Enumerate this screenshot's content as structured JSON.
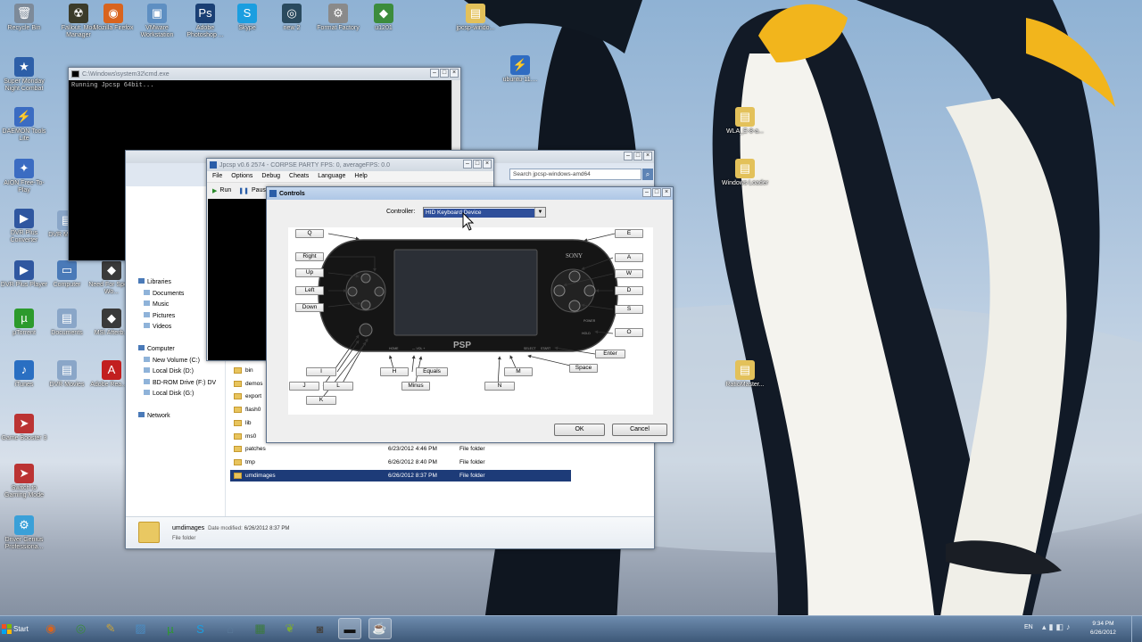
{
  "desktop": {
    "icons": [
      {
        "label": "Recycle Bin",
        "glyph": "🗑",
        "color": "#7d8a99"
      },
      {
        "label": "Fallout: Mod Manager",
        "glyph": "☢",
        "color": "#3b3b2a"
      },
      {
        "label": "Mozilla Firefox",
        "glyph": "◉",
        "color": "#d9641e"
      },
      {
        "label": "VMware Workstation",
        "glyph": "▣",
        "color": "#5e8fc2"
      },
      {
        "label": "Adobe Photoshop ...",
        "glyph": "Ps",
        "color": "#1a3f74"
      },
      {
        "label": "Skype",
        "glyph": "S",
        "color": "#1b9ee0"
      },
      {
        "label": "new 2",
        "glyph": "◎",
        "color": "#2a4a5e"
      },
      {
        "label": "Format Factory",
        "glyph": "⚙",
        "color": "#8a8a8a"
      },
      {
        "label": "u1201",
        "glyph": "◆",
        "color": "#3c8c3c"
      },
      {
        "label": "jpcsp-windo...",
        "glyph": "▤",
        "color": "#e3c15a"
      },
      {
        "label": "Super Monday Night Combat",
        "glyph": "★",
        "color": "#2d5fa8"
      },
      {
        "label": "DAEMON Tools Lite",
        "glyph": "⚡",
        "color": "#3b6cc2"
      },
      {
        "label": "AION Free-To-Play",
        "glyph": "✦",
        "color": "#3b6cc2"
      },
      {
        "label": "DVR Plus Converter",
        "glyph": "▶",
        "color": "#2f57a0"
      },
      {
        "label": "DVR Plus Player",
        "glyph": "▶",
        "color": "#2f57a0"
      },
      {
        "label": "μTorrent",
        "glyph": "µ",
        "color": "#2c9a2c"
      },
      {
        "label": "iTunes",
        "glyph": "♪",
        "color": "#2a6fc2"
      },
      {
        "label": "Game Booster 3",
        "glyph": "➤",
        "color": "#b33"
      },
      {
        "label": "Switch to Gaming Mode",
        "glyph": "➤",
        "color": "#b33"
      },
      {
        "label": "Driver Genius Professiona...",
        "glyph": "⚙",
        "color": "#3aa0d8"
      },
      {
        "label": "ubuntu-11....",
        "glyph": "⚡",
        "color": "#2f6cc2"
      },
      {
        "label": "WLA_E-8-a...",
        "glyph": "▤",
        "color": "#e3c15a"
      },
      {
        "label": "Windows Loader",
        "glyph": "▤",
        "color": "#e3c15a"
      },
      {
        "label": "RatioMaster...",
        "glyph": "▤",
        "color": "#e3c15a"
      },
      {
        "label": "Computer",
        "glyph": "▭",
        "color": "#4a7ab8"
      },
      {
        "label": "Documents",
        "glyph": "▤",
        "color": "#8aa6c8"
      },
      {
        "label": "DVR Movies",
        "glyph": "▤",
        "color": "#8aa6c8"
      },
      {
        "label": "Need For Speed Wo...",
        "glyph": "◆",
        "color": "#3a3a3a"
      },
      {
        "label": "MSI Afterb...",
        "glyph": "◆",
        "color": "#3a3a3a"
      },
      {
        "label": "Adobe Rea... X",
        "glyph": "A",
        "color": "#c21f1f"
      },
      {
        "label": "DVR MERT...",
        "glyph": "▤",
        "color": "#8aa6c8"
      }
    ]
  },
  "cmd_window": {
    "title": "C:\\Windows\\system32\\cmd.exe",
    "output": "Running Jpcsp 64bit..."
  },
  "jpcsp_window": {
    "title": "Jpcsp v0.6 2574 - CORPSE PARTY FPS: 0, averageFPS: 0.0",
    "menu": [
      "File",
      "Options",
      "Debug",
      "Cheats",
      "Language",
      "Help"
    ],
    "toolbar": {
      "run": "Run",
      "pause": "Paus"
    }
  },
  "explorer_window": {
    "search_placeholder": "Search jpcsp-windows-amd64",
    "tree": [
      {
        "label": "Libraries",
        "level": 0
      },
      {
        "label": "Documents",
        "level": 1
      },
      {
        "label": "Music",
        "level": 1
      },
      {
        "label": "Pictures",
        "level": 1
      },
      {
        "label": "Videos",
        "level": 1
      },
      {
        "label": "",
        "level": 0
      },
      {
        "label": "Computer",
        "level": 0
      },
      {
        "label": "New Volume (C:)",
        "level": 1
      },
      {
        "label": "Local Disk (D:)",
        "level": 1
      },
      {
        "label": "BD-ROM Drive (F:) DV",
        "level": 1
      },
      {
        "label": "Local Disk (G:)",
        "level": 1
      },
      {
        "label": "",
        "level": 0
      },
      {
        "label": "Network",
        "level": 0
      }
    ],
    "files": [
      {
        "name": "bin",
        "date": "",
        "type": ""
      },
      {
        "name": "demos",
        "date": "",
        "type": ""
      },
      {
        "name": "export",
        "date": "",
        "type": ""
      },
      {
        "name": "flash0",
        "date": "",
        "type": ""
      },
      {
        "name": "lib",
        "date": "",
        "type": ""
      },
      {
        "name": "ms0",
        "date": "",
        "type": ""
      },
      {
        "name": "patches",
        "date": "6/23/2012 4:46 PM",
        "type": "File folder"
      },
      {
        "name": "tmp",
        "date": "6/26/2012 8:40 PM",
        "type": "File folder"
      },
      {
        "name": "umdimages",
        "date": "6/26/2012 8:37 PM",
        "type": "File folder"
      }
    ],
    "details": {
      "name": "umdimages",
      "modified_label": "Date modified:",
      "modified": "6/26/2012 8:37 PM",
      "type": "File folder"
    }
  },
  "controls_dialog": {
    "title": "Controls",
    "controller_label": "Controller:",
    "controller_value": "HID Keyboard Device",
    "keys": {
      "ltrigger": "Q",
      "rtrigger": "E",
      "right": "Right",
      "up": "Up",
      "left": "Left",
      "down": "Down",
      "triangle": "A",
      "square": "W",
      "circle": "D",
      "cross": "S",
      "hold": "O",
      "start": "Enter",
      "select": "Space",
      "a_up": "I",
      "a_left": "J",
      "a_right": "L",
      "a_down": "K",
      "home": "H",
      "vol_up": "Equals",
      "vol_down": "Minus",
      "screen": "M",
      "note": "N"
    },
    "psp_labels": {
      "brand": "SONY",
      "logo": "PSP",
      "home": "HOME",
      "vol": "— VOL +",
      "select": "SELECT",
      "start": "START",
      "power": "POWER",
      "hold": "HOLD"
    },
    "ok": "OK",
    "cancel": "Cancel"
  },
  "taskbar": {
    "start": "Start",
    "lang": "EN",
    "time": "9:34 PM",
    "date": "6/26/2012"
  }
}
